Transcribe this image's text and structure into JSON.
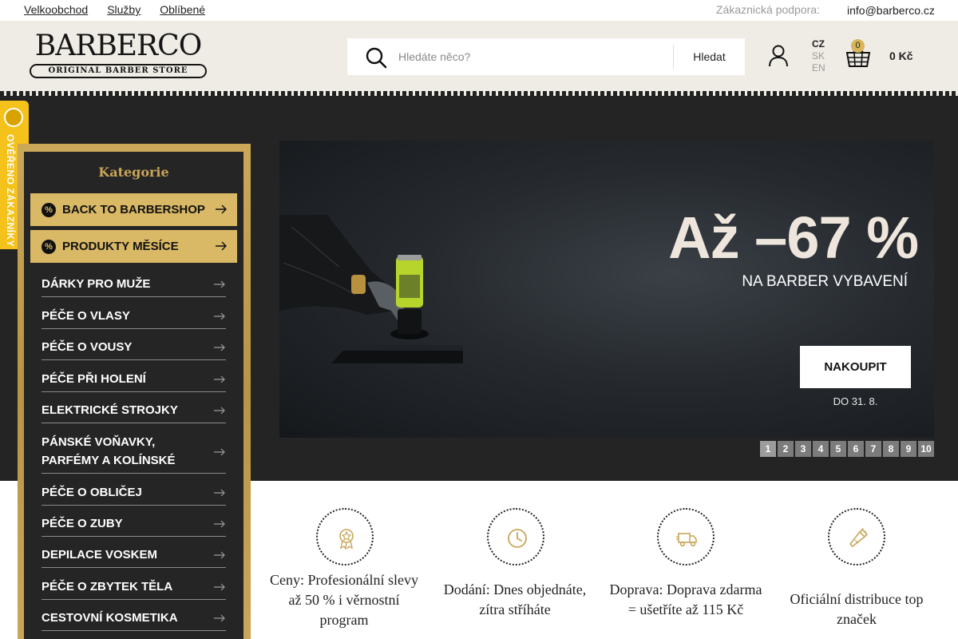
{
  "topbar": {
    "links": [
      "Velkoobchod",
      "Služby",
      "Oblíbené"
    ],
    "support_label": "Zákaznická podpora:",
    "support_email": "info@barberco.cz"
  },
  "header": {
    "logo_word": "BARBERCO",
    "logo_tagline": "ORIGINAL BARBER STORE",
    "search_placeholder": "Hledáte něco?",
    "search_button": "Hledat",
    "languages": [
      {
        "code": "CZ",
        "active": true
      },
      {
        "code": "SK",
        "active": false
      },
      {
        "code": "EN",
        "active": false
      }
    ],
    "cart_count": "0",
    "cart_total": "0 Kč",
    "accent_color": "#d8b45a"
  },
  "verified_badge": {
    "text": "OVĚŘENO ZÁKAZNÍKY",
    "color": "#f4c21a"
  },
  "categories": {
    "title": "Kategorie",
    "promos": [
      {
        "label": "BACK TO BARBERSHOP",
        "icon": "percent-badge-icon"
      },
      {
        "label": "PRODUKTY MĚSÍCE",
        "icon": "percent-badge-icon"
      }
    ],
    "items": [
      {
        "label": "DÁRKY PRO MUŽE"
      },
      {
        "label": "PÉČE O VLASY"
      },
      {
        "label": "PÉČE O VOUSY"
      },
      {
        "label": "PÉČE PŘI HOLENÍ"
      },
      {
        "label": "ELEKTRICKÉ STROJKY"
      },
      {
        "label": "PÁNSKÉ VOŇAVKY, PARFÉMY A KOLÍNSKÉ"
      },
      {
        "label": "PÉČE O OBLIČEJ"
      },
      {
        "label": "PÉČE O ZUBY"
      },
      {
        "label": "DEPILACE VOSKEM"
      },
      {
        "label": "PÉČE O ZBYTEK TĚLA"
      },
      {
        "label": "CESTOVNÍ KOSMETIKA"
      }
    ]
  },
  "banner": {
    "headline": "Až –67 %",
    "subline": "NA BARBER VYBAVENÍ",
    "cta": "NAKOUPIT",
    "date": "DO 31. 8.",
    "pages": [
      "1",
      "2",
      "3",
      "4",
      "5",
      "6",
      "7",
      "8",
      "9",
      "10"
    ],
    "active_page": "1"
  },
  "benefits": [
    {
      "icon": "award-icon",
      "text": "Ceny: Profesionální slevy až 50 % i věrnostní program"
    },
    {
      "icon": "clock-icon",
      "text": "Dodání: Dnes objednáte, zítra stříháte"
    },
    {
      "icon": "delivery-truck-icon",
      "text": "Doprava: Doprava zdarma = ušetříte až 115 Kč"
    },
    {
      "icon": "trimmer-icon",
      "text": "Oficiální distribuce top značek"
    }
  ]
}
